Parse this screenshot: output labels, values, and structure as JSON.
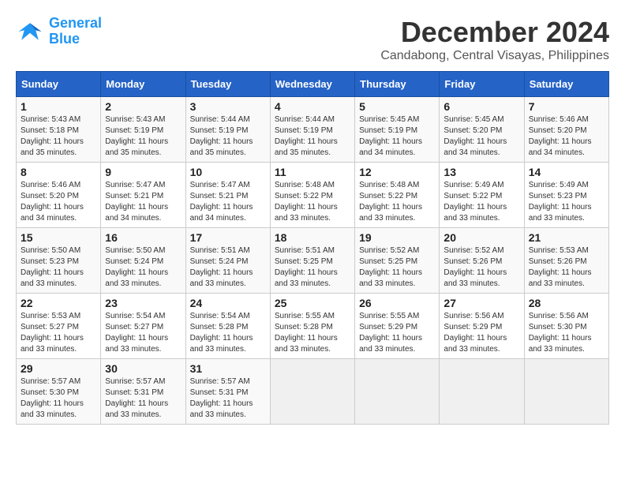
{
  "logo": {
    "line1": "General",
    "line2": "Blue"
  },
  "title": "December 2024",
  "location": "Candabong, Central Visayas, Philippines",
  "days_of_week": [
    "Sunday",
    "Monday",
    "Tuesday",
    "Wednesday",
    "Thursday",
    "Friday",
    "Saturday"
  ],
  "weeks": [
    [
      {
        "day": "1",
        "info": "Sunrise: 5:43 AM\nSunset: 5:18 PM\nDaylight: 11 hours\nand 35 minutes."
      },
      {
        "day": "2",
        "info": "Sunrise: 5:43 AM\nSunset: 5:19 PM\nDaylight: 11 hours\nand 35 minutes."
      },
      {
        "day": "3",
        "info": "Sunrise: 5:44 AM\nSunset: 5:19 PM\nDaylight: 11 hours\nand 35 minutes."
      },
      {
        "day": "4",
        "info": "Sunrise: 5:44 AM\nSunset: 5:19 PM\nDaylight: 11 hours\nand 35 minutes."
      },
      {
        "day": "5",
        "info": "Sunrise: 5:45 AM\nSunset: 5:19 PM\nDaylight: 11 hours\nand 34 minutes."
      },
      {
        "day": "6",
        "info": "Sunrise: 5:45 AM\nSunset: 5:20 PM\nDaylight: 11 hours\nand 34 minutes."
      },
      {
        "day": "7",
        "info": "Sunrise: 5:46 AM\nSunset: 5:20 PM\nDaylight: 11 hours\nand 34 minutes."
      }
    ],
    [
      {
        "day": "8",
        "info": "Sunrise: 5:46 AM\nSunset: 5:20 PM\nDaylight: 11 hours\nand 34 minutes."
      },
      {
        "day": "9",
        "info": "Sunrise: 5:47 AM\nSunset: 5:21 PM\nDaylight: 11 hours\nand 34 minutes."
      },
      {
        "day": "10",
        "info": "Sunrise: 5:47 AM\nSunset: 5:21 PM\nDaylight: 11 hours\nand 34 minutes."
      },
      {
        "day": "11",
        "info": "Sunrise: 5:48 AM\nSunset: 5:22 PM\nDaylight: 11 hours\nand 33 minutes."
      },
      {
        "day": "12",
        "info": "Sunrise: 5:48 AM\nSunset: 5:22 PM\nDaylight: 11 hours\nand 33 minutes."
      },
      {
        "day": "13",
        "info": "Sunrise: 5:49 AM\nSunset: 5:22 PM\nDaylight: 11 hours\nand 33 minutes."
      },
      {
        "day": "14",
        "info": "Sunrise: 5:49 AM\nSunset: 5:23 PM\nDaylight: 11 hours\nand 33 minutes."
      }
    ],
    [
      {
        "day": "15",
        "info": "Sunrise: 5:50 AM\nSunset: 5:23 PM\nDaylight: 11 hours\nand 33 minutes."
      },
      {
        "day": "16",
        "info": "Sunrise: 5:50 AM\nSunset: 5:24 PM\nDaylight: 11 hours\nand 33 minutes."
      },
      {
        "day": "17",
        "info": "Sunrise: 5:51 AM\nSunset: 5:24 PM\nDaylight: 11 hours\nand 33 minutes."
      },
      {
        "day": "18",
        "info": "Sunrise: 5:51 AM\nSunset: 5:25 PM\nDaylight: 11 hours\nand 33 minutes."
      },
      {
        "day": "19",
        "info": "Sunrise: 5:52 AM\nSunset: 5:25 PM\nDaylight: 11 hours\nand 33 minutes."
      },
      {
        "day": "20",
        "info": "Sunrise: 5:52 AM\nSunset: 5:26 PM\nDaylight: 11 hours\nand 33 minutes."
      },
      {
        "day": "21",
        "info": "Sunrise: 5:53 AM\nSunset: 5:26 PM\nDaylight: 11 hours\nand 33 minutes."
      }
    ],
    [
      {
        "day": "22",
        "info": "Sunrise: 5:53 AM\nSunset: 5:27 PM\nDaylight: 11 hours\nand 33 minutes."
      },
      {
        "day": "23",
        "info": "Sunrise: 5:54 AM\nSunset: 5:27 PM\nDaylight: 11 hours\nand 33 minutes."
      },
      {
        "day": "24",
        "info": "Sunrise: 5:54 AM\nSunset: 5:28 PM\nDaylight: 11 hours\nand 33 minutes."
      },
      {
        "day": "25",
        "info": "Sunrise: 5:55 AM\nSunset: 5:28 PM\nDaylight: 11 hours\nand 33 minutes."
      },
      {
        "day": "26",
        "info": "Sunrise: 5:55 AM\nSunset: 5:29 PM\nDaylight: 11 hours\nand 33 minutes."
      },
      {
        "day": "27",
        "info": "Sunrise: 5:56 AM\nSunset: 5:29 PM\nDaylight: 11 hours\nand 33 minutes."
      },
      {
        "day": "28",
        "info": "Sunrise: 5:56 AM\nSunset: 5:30 PM\nDaylight: 11 hours\nand 33 minutes."
      }
    ],
    [
      {
        "day": "29",
        "info": "Sunrise: 5:57 AM\nSunset: 5:30 PM\nDaylight: 11 hours\nand 33 minutes."
      },
      {
        "day": "30",
        "info": "Sunrise: 5:57 AM\nSunset: 5:31 PM\nDaylight: 11 hours\nand 33 minutes."
      },
      {
        "day": "31",
        "info": "Sunrise: 5:57 AM\nSunset: 5:31 PM\nDaylight: 11 hours\nand 33 minutes."
      },
      {
        "day": "",
        "info": ""
      },
      {
        "day": "",
        "info": ""
      },
      {
        "day": "",
        "info": ""
      },
      {
        "day": "",
        "info": ""
      }
    ]
  ]
}
